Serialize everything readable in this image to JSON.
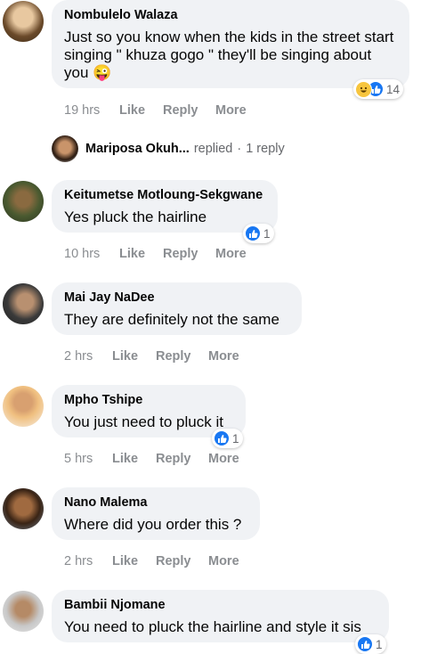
{
  "comments": [
    {
      "name": "Nombulelo Walaza",
      "text": "Just so you know when the kids in the street start singing \" khuza gogo \" they'll be singing about you",
      "emoji": "😜",
      "time": "19 hrs",
      "like": "Like",
      "reply": "Reply",
      "more": "More",
      "reaction_count": "14",
      "reactions": [
        "haha-icon",
        "like-icon"
      ]
    },
    {
      "name": "Keitumetse Motloung-Sekgwane",
      "text": "Yes pluck the hairline",
      "time": "10 hrs",
      "like": "Like",
      "reply": "Reply",
      "more": "More",
      "reaction_count": "1",
      "reactions": [
        "like-icon"
      ]
    },
    {
      "name": "Mai Jay NaDee",
      "text": "They are definitely not the same",
      "time": "2 hrs",
      "like": "Like",
      "reply": "Reply",
      "more": "More"
    },
    {
      "name": "Mpho Tshipe",
      "text": "You just need to pluck it",
      "time": "5 hrs",
      "like": "Like",
      "reply": "Reply",
      "more": "More",
      "reaction_count": "1",
      "reactions": [
        "like-icon"
      ]
    },
    {
      "name": "Nano Malema",
      "text": "Where did you order this ?",
      "time": "2 hrs",
      "like": "Like",
      "reply": "Reply",
      "more": "More"
    },
    {
      "name": "Bambii Njomane",
      "text": "You need to pluck the hairline and style it sis",
      "reaction_count": "1",
      "reactions": [
        "like-icon"
      ]
    }
  ],
  "reply_preview": {
    "name": "Mariposa Okuh...",
    "action": "replied",
    "separator": "·",
    "count": "1 reply"
  },
  "colors": {
    "bubble": "#f0f2f5",
    "meta": "#8a8d91",
    "like_blue": "#1877f2",
    "haha_yellow": "#f7c53e"
  }
}
